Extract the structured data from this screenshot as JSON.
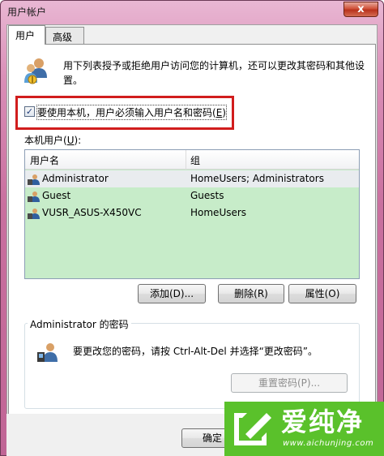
{
  "window": {
    "title": "用户帐户",
    "close_glyph": "x"
  },
  "tabs": [
    {
      "label": "用户",
      "active": true
    },
    {
      "label": "高级",
      "active": false
    }
  ],
  "intro": {
    "text": "用下列表授予或拒绝用户访问您的计算机，还可以更改其密码和其他设置。"
  },
  "require_login": {
    "checked": true,
    "check_glyph": "✓",
    "label_prefix": "要使用本机，用户必须输入用户名和密码(",
    "accesskey": "E",
    "label_suffix": ")"
  },
  "local_users": {
    "label_prefix": "本机用户(",
    "accesskey": "U",
    "label_suffix": "):",
    "columns": [
      "用户名",
      "组"
    ],
    "rows": [
      {
        "name": "Administrator",
        "group": "HomeUsers; Administrators",
        "selected": true
      },
      {
        "name": "Guest",
        "group": "Guests",
        "selected": false
      },
      {
        "name": "VUSR_ASUS-X450VC",
        "group": "HomeUsers",
        "selected": false
      }
    ]
  },
  "buttons": {
    "add": "添加(D)...",
    "delete": "删除(R)",
    "properties": "属性(O)",
    "reset_password": "重置密码(P)...",
    "ok": "确定"
  },
  "password_group": {
    "legend": "Administrator 的密码",
    "text": "要更改您的密码，请按 Ctrl-Alt-Del 并选择“更改密码”。"
  },
  "watermark": {
    "brand": "爱纯净",
    "url": "www.aichunjing.com"
  },
  "colors": {
    "list_background": "#c7ecc9",
    "highlight": "#d11d1d",
    "watermark": "#5ac12b"
  }
}
